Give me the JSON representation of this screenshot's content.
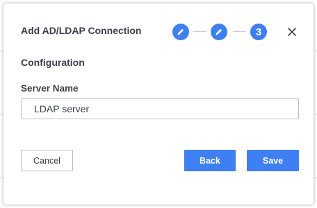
{
  "dialog": {
    "title": "Add AD/LDAP Connection",
    "steps": [
      {
        "state": "completed",
        "icon": "pencil-icon"
      },
      {
        "state": "completed",
        "icon": "pencil-icon"
      },
      {
        "state": "current",
        "number": "3"
      }
    ],
    "close_icon": "close-icon",
    "section_title": "Configuration",
    "server_name": {
      "label": "Server Name",
      "value": "LDAP server"
    },
    "buttons": {
      "cancel": "Cancel",
      "back": "Back",
      "save": "Save"
    }
  },
  "colors": {
    "accent": "#3e7ff2",
    "text": "#3c3f4a",
    "border": "#b9bcc4"
  }
}
